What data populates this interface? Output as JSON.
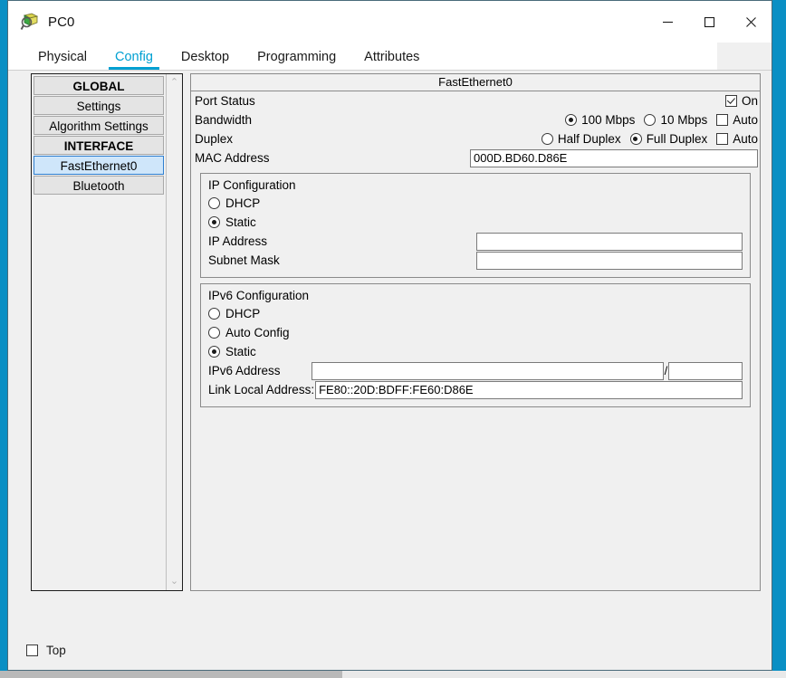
{
  "window": {
    "title": "PC0",
    "icon": "packet-tracer-device-icon",
    "minimize_label": "—",
    "maximize_label": "□",
    "close_label": "✕"
  },
  "tabs": [
    {
      "label": "Physical",
      "active": false
    },
    {
      "label": "Config",
      "active": true
    },
    {
      "label": "Desktop",
      "active": false
    },
    {
      "label": "Programming",
      "active": false
    },
    {
      "label": "Attributes",
      "active": false
    }
  ],
  "sidebar": {
    "items": [
      {
        "label": "GLOBAL",
        "type": "header",
        "selected": false
      },
      {
        "label": "Settings",
        "type": "item",
        "selected": false
      },
      {
        "label": "Algorithm Settings",
        "type": "item",
        "selected": false
      },
      {
        "label": "INTERFACE",
        "type": "header",
        "selected": false
      },
      {
        "label": "FastEthernet0",
        "type": "item",
        "selected": true
      },
      {
        "label": "Bluetooth",
        "type": "item",
        "selected": false
      }
    ],
    "scroll_up": "⌃",
    "scroll_down": "⌄"
  },
  "panel": {
    "title": "FastEthernet0",
    "port_status": {
      "label": "Port Status",
      "on_label": "On",
      "checked": true
    },
    "bandwidth": {
      "label": "Bandwidth",
      "option_100_label": "100 Mbps",
      "option_100_selected": true,
      "option_10_label": "10 Mbps",
      "option_10_selected": false,
      "auto_label": "Auto",
      "auto_checked": false
    },
    "duplex": {
      "label": "Duplex",
      "half_label": "Half Duplex",
      "half_selected": false,
      "full_label": "Full Duplex",
      "full_selected": true,
      "auto_label": "Auto",
      "auto_checked": false
    },
    "mac": {
      "label": "MAC Address",
      "value": "000D.BD60.D86E"
    },
    "ip_config": {
      "title": "IP Configuration",
      "dhcp_label": "DHCP",
      "dhcp_selected": false,
      "static_label": "Static",
      "static_selected": true,
      "ip_address_label": "IP Address",
      "ip_address_value": "",
      "subnet_mask_label": "Subnet Mask",
      "subnet_mask_value": ""
    },
    "ipv6_config": {
      "title": "IPv6 Configuration",
      "dhcp_label": "DHCP",
      "dhcp_selected": false,
      "auto_config_label": "Auto Config",
      "auto_config_selected": false,
      "static_label": "Static",
      "static_selected": true,
      "ipv6_address_label": "IPv6 Address",
      "ipv6_address_value": "",
      "prefix_separator": "/",
      "prefix_value": "",
      "link_local_label": "Link Local Address:",
      "link_local_value": "FE80::20D:BDFF:FE60:D86E"
    }
  },
  "footer": {
    "top_label": "Top",
    "top_checked": false
  },
  "colors": {
    "accent": "#00a0d2",
    "selection": "#cfe6fa",
    "window_bg": "#f0f0f0",
    "desktop": "#0a8fc4"
  }
}
